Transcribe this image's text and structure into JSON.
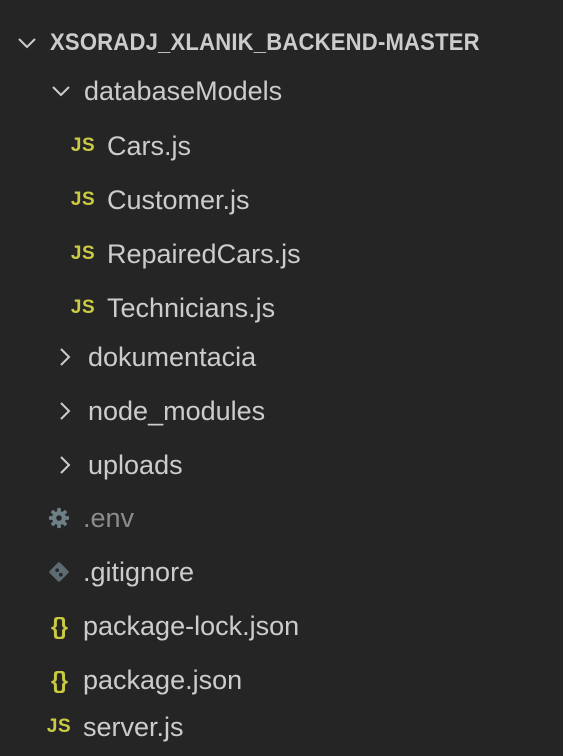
{
  "explorer": {
    "root": {
      "label": "XSORADJ_XLANIK_BACKEND-MASTER",
      "expanded": true
    },
    "database_models": {
      "label": "databaseModels",
      "expanded": true,
      "files": [
        {
          "label": "Cars.js",
          "icon": "js-icon",
          "badge": "JS"
        },
        {
          "label": "Customer.js",
          "icon": "js-icon",
          "badge": "JS"
        },
        {
          "label": "RepairedCars.js",
          "icon": "js-icon",
          "badge": "JS"
        },
        {
          "label": "Technicians.js",
          "icon": "js-icon",
          "badge": "JS"
        }
      ]
    },
    "folders": [
      {
        "label": "dokumentacia",
        "expanded": false
      },
      {
        "label": "node_modules",
        "expanded": false
      },
      {
        "label": "uploads",
        "expanded": false
      }
    ],
    "root_files": [
      {
        "label": ".env",
        "icon": "gear-icon"
      },
      {
        "label": ".gitignore",
        "icon": "git-icon"
      },
      {
        "label": "package-lock.json",
        "icon": "json-braces-icon",
        "badge": "{}"
      },
      {
        "label": "package.json",
        "icon": "json-braces-icon",
        "badge": "{}"
      },
      {
        "label": "server.js",
        "icon": "js-icon",
        "badge": "JS"
      }
    ]
  },
  "colors": {
    "background": "#252526",
    "text": "#cccccc",
    "text_dim": "#8c8c8c",
    "js_badge": "#cbcb41",
    "json_badge": "#cbcb41",
    "gear_icon": "#6d8086",
    "git_icon": "#5f6b73"
  }
}
